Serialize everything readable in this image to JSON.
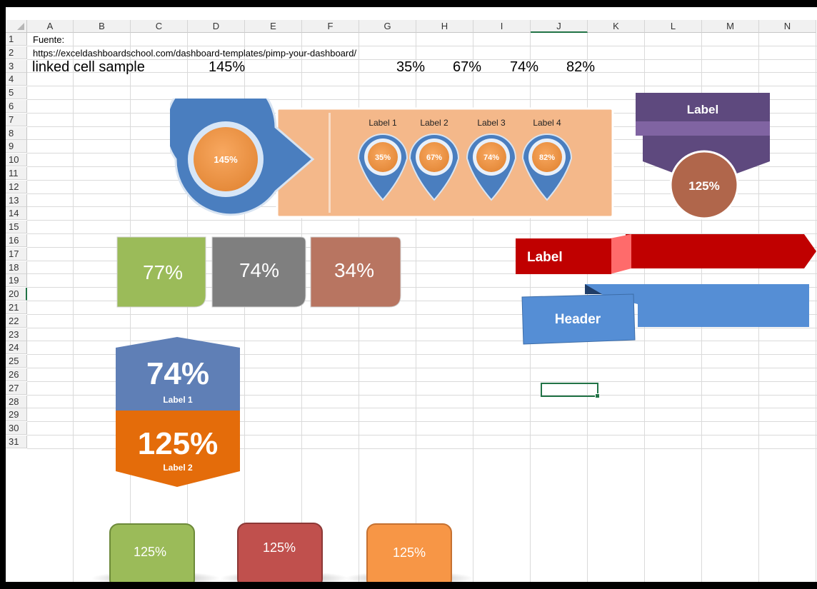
{
  "sheet": {
    "columns": [
      "A",
      "B",
      "C",
      "D",
      "E",
      "F",
      "G",
      "H",
      "I",
      "J",
      "K",
      "L",
      "M",
      "N"
    ],
    "rows": [
      "1",
      "2",
      "3",
      "4",
      "5",
      "6",
      "7",
      "8",
      "9",
      "10",
      "11",
      "12",
      "13",
      "14",
      "15",
      "16",
      "17",
      "18",
      "19",
      "20",
      "21",
      "22",
      "23",
      "24",
      "25",
      "26",
      "27",
      "28",
      "29",
      "30",
      "31"
    ],
    "selected_cell": "J20"
  },
  "cells": {
    "a1": "Fuente:",
    "a2": "https://exceldashboardschool.com/dashboard-templates/pimp-your-dashboard/",
    "a3": "linked cell sample",
    "d3": "145%",
    "g3": "35%",
    "h3": "67%",
    "i3": "74%",
    "j3": "82%"
  },
  "pin_panel": {
    "main_value": "145%",
    "pins": [
      {
        "label": "Label 1",
        "value": "35%"
      },
      {
        "label": "Label 2",
        "value": "67%"
      },
      {
        "label": "Label 3",
        "value": "74%"
      },
      {
        "label": "Label 4",
        "value": "82%"
      }
    ]
  },
  "purple_badge": {
    "label": "Label",
    "value": "125%"
  },
  "tiles": [
    {
      "value": "77%",
      "color": "#9bbb59"
    },
    {
      "value": "74%",
      "color": "#7f7f7f"
    },
    {
      "value": "34%",
      "color": "#b87561"
    }
  ],
  "red_ribbon": {
    "label": "Label",
    "color": "#c00000"
  },
  "blue_ribbon": {
    "label": "Header",
    "color": "#558ed5"
  },
  "hexagon": {
    "top_value": "74%",
    "top_label": "Label 1",
    "top_color": "#5f7fb6",
    "bottom_value": "125%",
    "bottom_label": "Label 2",
    "bottom_color": "#e46c0a"
  },
  "buttons": [
    {
      "value": "125%",
      "color": "#9bbb59"
    },
    {
      "value": "125%",
      "color": "#c0504d"
    },
    {
      "value": "125%",
      "color": "#f79646"
    }
  ]
}
